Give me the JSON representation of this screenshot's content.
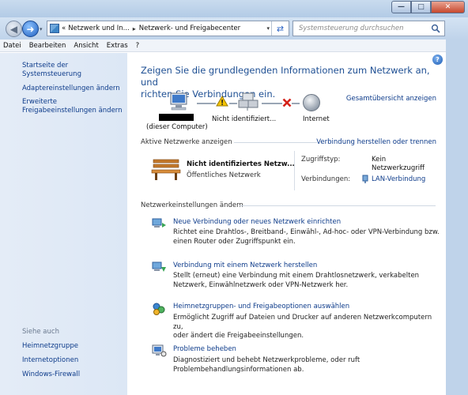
{
  "window": {
    "minimize_glyph": "—",
    "maximize_glyph": "□",
    "close_glyph": "✕"
  },
  "address_bar": {
    "crumb_prefix": "«",
    "crumb_1": "Netzwerk und In...",
    "crumb_2": "Netzwerk- und Freigabecenter",
    "search_placeholder": "Systemsteuerung durchsuchen"
  },
  "menu": {
    "items": [
      "Datei",
      "Bearbeiten",
      "Ansicht",
      "Extras",
      "?"
    ]
  },
  "sidebar": {
    "home": "Startseite der Systemsteuerung",
    "links": [
      "Adaptereinstellungen ändern",
      "Erweiterte",
      "Freigabeeinstellungen ändern"
    ],
    "see_also_title": "Siehe auch",
    "see_also": [
      "Heimnetzgruppe",
      "Internetoptionen",
      "Windows-Firewall"
    ]
  },
  "main": {
    "headline_line1": "Zeigen Sie die grundlegenden Informationen zum Netzwerk an, und",
    "headline_line2": "richten Sie Verbindungen ein.",
    "overview_link": "Gesamtübersicht anzeigen",
    "map": {
      "computer_label": "(dieser Computer)",
      "network_label": "Nicht identifiziert...",
      "internet_label": "Internet"
    },
    "active_networks": {
      "header": "Aktive Netzwerke anzeigen",
      "link": "Verbindung herstellen oder trennen",
      "network_name": "Nicht identifiziertes Netzw...",
      "network_type": "Öffentliches Netzwerk",
      "access_label": "Zugriffstyp:",
      "access_value_1": "Kein",
      "access_value_2": "Netzwerkzugriff",
      "connections_label": "Verbindungen:",
      "connections_value": "LAN-Verbindung"
    },
    "settings": {
      "header": "Netzwerkeinstellungen ändern",
      "tasks": [
        {
          "title": "Neue Verbindung oder neues Netzwerk einrichten",
          "desc1": "Richtet eine Drahtlos-, Breitband-, Einwähl-, Ad-hoc- oder VPN-Verbindung bzw.",
          "desc2": "einen Router oder Zugriffspunkt ein."
        },
        {
          "title": "Verbindung mit einem Netzwerk herstellen",
          "desc1": "Stellt (erneut) eine Verbindung mit einem Drahtlosnetzwerk, verkabelten",
          "desc2": "Netzwerk, Einwählnetzwerk oder VPN-Netzwerk her."
        },
        {
          "title": "Heimnetzgruppen- und Freigabeoptionen auswählen",
          "desc1": "Ermöglicht Zugriff auf Dateien und Drucker auf anderen Netzwerkcomputern zu,",
          "desc2": "oder ändert die Freigabeeinstellungen."
        },
        {
          "title": "Probleme beheben",
          "desc1": "Diagnostiziert und behebt Netzwerkprobleme, oder ruft",
          "desc2": "Problembehandlungsinformationen ab."
        }
      ]
    }
  },
  "icons": {
    "back": "arrow-left-icon",
    "forward": "arrow-right-icon",
    "refresh": "refresh-icon",
    "search": "search-icon",
    "help": "help-icon",
    "computer": "computer-icon",
    "warning": "warning-icon",
    "network": "network-icon",
    "error": "red-x-icon",
    "globe": "globe-icon",
    "bench": "park-bench-icon",
    "lan": "network-adapter-icon"
  },
  "colors": {
    "link": "#0d3b8a",
    "headline": "#1e4f93",
    "sidebar_bg": "#dce7f5"
  }
}
